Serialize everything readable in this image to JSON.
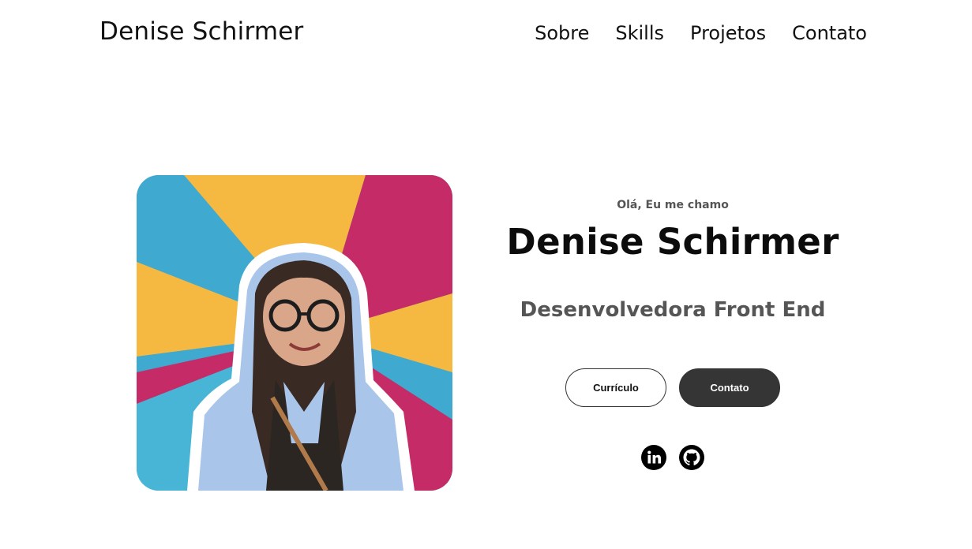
{
  "header": {
    "brand": "Denise Schirmer",
    "nav": [
      {
        "label": "Sobre"
      },
      {
        "label": "Skills"
      },
      {
        "label": "Projetos"
      },
      {
        "label": "Contato"
      }
    ]
  },
  "hero": {
    "greeting": "Olá, Eu me chamo",
    "name": "Denise Schirmer",
    "role": "Desenvolvedora Front End",
    "buttons": {
      "cv": "Currículo",
      "contact": "Contato"
    },
    "social": [
      {
        "icon": "linkedin-icon"
      },
      {
        "icon": "github-icon"
      }
    ]
  },
  "colors": {
    "background": "#ffffff",
    "primary_button": "#353535",
    "muted_text": "#555555",
    "photo_blue": "#3fa9cf",
    "photo_yellow": "#f5b942",
    "photo_magenta": "#c42b67"
  }
}
